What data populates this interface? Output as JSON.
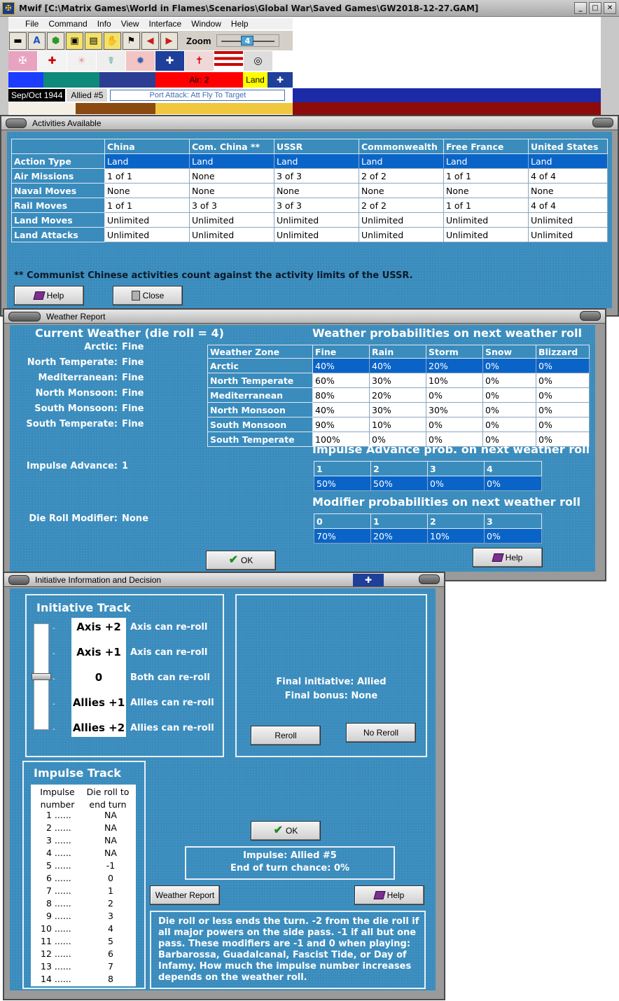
{
  "app": {
    "title": "Mwif [C:\\Matrix Games\\World in Flames\\Scenarios\\Global War\\Saved Games\\GW2018-12-27.GAM]",
    "menu": [
      "File",
      "Command",
      "Info",
      "View",
      "Interface",
      "Window",
      "Help"
    ],
    "zoom_label": "Zoom",
    "zoom_value": "4",
    "status_air": "Air: 2",
    "status_land": "Land",
    "date": "Sep/Oct 1944",
    "phase": "Allied #5",
    "action": "Port Attack: Att Fly To Target"
  },
  "activities": {
    "title": "Activities Available",
    "columns": [
      "China",
      "Com. China **",
      "USSR",
      "Commonwealth",
      "Free France",
      "United States"
    ],
    "rows": [
      {
        "label": "Action Type",
        "values": [
          "Land",
          "Land",
          "Land",
          "Land",
          "Land",
          "Land"
        ]
      },
      {
        "label": "Air Missions",
        "values": [
          "1 of 1",
          "None",
          "3 of 3",
          "2 of 2",
          "1 of 1",
          "4 of 4"
        ]
      },
      {
        "label": "Naval Moves",
        "values": [
          "None",
          "None",
          "None",
          "None",
          "None",
          "None"
        ]
      },
      {
        "label": "Rail Moves",
        "values": [
          "1 of 1",
          "3 of 3",
          "3 of 3",
          "2 of 2",
          "1 of 1",
          "4 of 4"
        ]
      },
      {
        "label": "Land Moves",
        "values": [
          "Unlimited",
          "Unlimited",
          "Unlimited",
          "Unlimited",
          "Unlimited",
          "Unlimited"
        ]
      },
      {
        "label": "Land Attacks",
        "values": [
          "Unlimited",
          "Unlimited",
          "Unlimited",
          "Unlimited",
          "Unlimited",
          "Unlimited"
        ]
      }
    ],
    "note": "** Communist Chinese activities count against the activity limits of the USSR.",
    "help_label": "Help",
    "close_label": "Close"
  },
  "weather": {
    "title": "Weather Report",
    "current_heading": "Current Weather (die roll = 4)",
    "zones": [
      {
        "name": "Arctic:",
        "value": "Fine"
      },
      {
        "name": "North Temperate:",
        "value": "Fine"
      },
      {
        "name": "Mediterranean:",
        "value": "Fine"
      },
      {
        "name": "North Monsoon:",
        "value": "Fine"
      },
      {
        "name": "South Monsoon:",
        "value": "Fine"
      },
      {
        "name": "South Temperate:",
        "value": "Fine"
      }
    ],
    "prob_heading": "Weather probabilities on next weather roll",
    "prob_columns": [
      "Weather Zone",
      "Fine",
      "Rain",
      "Storm",
      "Snow",
      "Blizzard"
    ],
    "prob_rows": [
      {
        "zone": "Arctic",
        "values": [
          "40%",
          "40%",
          "20%",
          "0%",
          "0%"
        ]
      },
      {
        "zone": "North Temperate",
        "values": [
          "60%",
          "30%",
          "10%",
          "0%",
          "0%"
        ]
      },
      {
        "zone": "Mediterranean",
        "values": [
          "80%",
          "20%",
          "0%",
          "0%",
          "0%"
        ]
      },
      {
        "zone": "North Monsoon",
        "values": [
          "40%",
          "30%",
          "30%",
          "0%",
          "0%"
        ]
      },
      {
        "zone": "South Monsoon",
        "values": [
          "90%",
          "10%",
          "0%",
          "0%",
          "0%"
        ]
      },
      {
        "zone": "South Temperate",
        "values": [
          "100%",
          "0%",
          "0%",
          "0%",
          "0%"
        ]
      }
    ],
    "impulse_label": "Impulse Advance:",
    "impulse_value": "1",
    "impulse_heading": "Impulse Advance prob. on next weather roll",
    "impulse_columns": [
      "1",
      "2",
      "3",
      "4"
    ],
    "impulse_values": [
      "50%",
      "50%",
      "0%",
      "0%"
    ],
    "modifier_label": "Die Roll Modifier:",
    "modifier_value": "None",
    "modifier_heading": "Modifier probabilities on next weather roll",
    "modifier_columns": [
      "0",
      "1",
      "2",
      "3"
    ],
    "modifier_values": [
      "70%",
      "20%",
      "10%",
      "0%"
    ],
    "ok_label": "OK",
    "help_label": "Help"
  },
  "initiative": {
    "title": "Initiative Information and Decision",
    "track_heading": "Initiative Track",
    "track": [
      {
        "label": "Axis +2",
        "desc": "Axis can re-roll"
      },
      {
        "label": "Axis +1",
        "desc": "Axis can re-roll"
      },
      {
        "label": "0",
        "desc": "Both can re-roll"
      },
      {
        "label": "Allies +1",
        "desc": "Allies can re-roll"
      },
      {
        "label": "Allies +2",
        "desc": "Allies can re-roll"
      }
    ],
    "final_initiative": "Final initiative: Allied",
    "final_bonus": "Final bonus: None",
    "reroll_label": "Reroll",
    "noreroll_label": "No Reroll",
    "impulse_heading": "Impulse Track",
    "impulse_col1": [
      "Impulse",
      "number"
    ],
    "impulse_col2": [
      "Die roll to",
      "end turn"
    ],
    "impulse_rows": [
      {
        "n": "1 ......",
        "v": "NA"
      },
      {
        "n": "2 ......",
        "v": "NA"
      },
      {
        "n": "3 ......",
        "v": "NA"
      },
      {
        "n": "4 ......",
        "v": "NA"
      },
      {
        "n": "5 ......",
        "v": "-1"
      },
      {
        "n": "6 ......",
        "v": "0"
      },
      {
        "n": "7 ......",
        "v": "1"
      },
      {
        "n": "8 ......",
        "v": "2"
      },
      {
        "n": "9 ......",
        "v": "3"
      },
      {
        "n": "10 ......",
        "v": "4"
      },
      {
        "n": "11 ......",
        "v": "5"
      },
      {
        "n": "12 ......",
        "v": "6"
      },
      {
        "n": "13 ......",
        "v": "7"
      },
      {
        "n": "14 ......",
        "v": "8"
      }
    ],
    "ok_label": "OK",
    "impulse_status": "Impulse: Allied #5",
    "end_turn_chance": "End of turn chance: 0%",
    "weather_report_label": "Weather Report",
    "help_label": "Help",
    "explanation": "Die roll or less ends the turn.  -2 from the die roll if all major powers on the side pass.  -1 if all but one pass.  These modifiers are -1 and 0 when playing: Barbarossa, Guadalcanal, Fascist Tide, or Day of Infamy.  How much the impulse number increases depends on the weather roll."
  },
  "colors": {
    "panel_blue": "#3a8cbd",
    "selection_blue": "#0a64c8"
  }
}
